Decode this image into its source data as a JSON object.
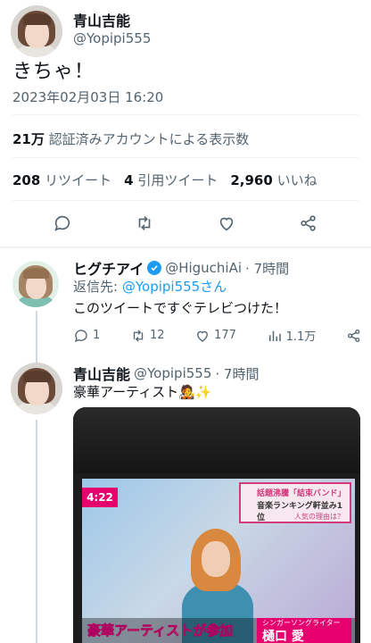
{
  "main_tweet": {
    "author_name": "青山吉能",
    "author_handle": "@Yopipi555",
    "text": "きちゃ！",
    "timestamp": "2023年02月03日 16:20",
    "views_count": "21万",
    "views_label": "認証済みアカウントによる表示数",
    "retweets_count": "208",
    "retweets_label": "リツイート",
    "quotes_count": "4",
    "quotes_label": "引用ツイート",
    "likes_count": "2,960",
    "likes_label": "いいね",
    "actions": [
      "reply-icon",
      "retweet-icon",
      "like-icon",
      "share-icon"
    ]
  },
  "reply_1": {
    "author_name": "ヒグチアイ",
    "author_handle": "@HiguchiAi",
    "time": "· 7時間",
    "reply_to_label": "返信先:",
    "reply_to_handle": "@Yopipi555さん",
    "text": "このツイートですぐテレビつけた！",
    "reply_count": "1",
    "retweet_count": "12",
    "like_count": "177",
    "view_count": "1.1万"
  },
  "reply_2": {
    "author_name": "青山吉能",
    "author_handle": "@Yopipi555",
    "time": "· 7時間",
    "text": "豪華アーティスト🧑‍🎤✨",
    "media": {
      "clock": "4:22",
      "banner_line1": "話題沸騰「結束バンド」",
      "banner_line2": "音楽ランキング軒並み1位",
      "banner_line3": "人気の理由は？",
      "caption": "豪華アーティストが参加",
      "caption_sub": "シンガーソングライター",
      "caption_name": "樋口 愛"
    }
  },
  "colors": {
    "accent": "#1d9bf0",
    "secondary_text": "#536471",
    "divider": "#eff3f4",
    "tv_pink": "#e5006e"
  }
}
